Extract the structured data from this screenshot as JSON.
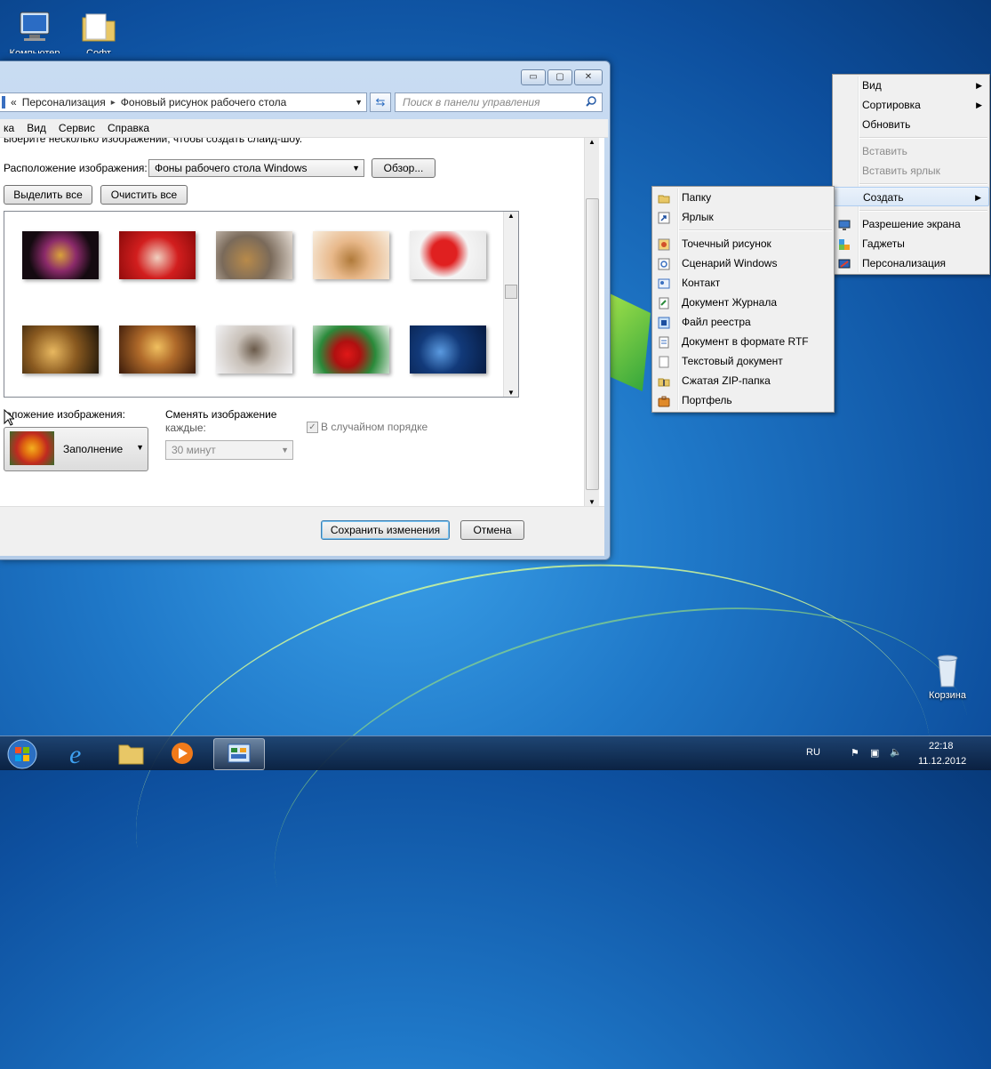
{
  "desktop": {
    "icons": [
      {
        "label": "Компьютер"
      },
      {
        "label": "Софт"
      },
      {
        "label": "Корзина"
      }
    ]
  },
  "window": {
    "controls": {
      "minimize": "▭",
      "maximize": "▢",
      "close": "✕"
    },
    "breadcrumb": {
      "sep": "«",
      "crumb1": "Персонализация",
      "crumb2": "Фоновый рисунок рабочего стола",
      "arrow": "▸"
    },
    "search_placeholder": "Поиск в панели управления",
    "menu": [
      "ка",
      "Вид",
      "Сервис",
      "Справка"
    ],
    "intro_text": "ыберите несколько изображений, чтобы создать слайд-шоу.",
    "location_label": "Расположение изображения:",
    "location_value": "Фоны рабочего стола Windows",
    "browse_label": "Обзор...",
    "select_all_label": "Выделить все",
    "clear_all_label": "Очистить все",
    "position_label": "оложение изображения:",
    "position_value": "Заполнение",
    "change_label_1": "Сменять изображение",
    "change_label_2": "каждые:",
    "interval_value": "30 минут",
    "shuffle_label": "В случайном порядке",
    "save_label": "Сохранить изменения",
    "cancel_label": "Отмена"
  },
  "context_menu": {
    "items": [
      {
        "label": "Вид",
        "sub": "▶"
      },
      {
        "label": "Сортировка",
        "sub": "▶"
      },
      {
        "label": "Обновить"
      },
      {
        "label": "Вставить"
      },
      {
        "label": "Вставить ярлык"
      },
      {
        "label": "Создать",
        "sub": "▶"
      },
      {
        "label": "Разрешение экрана"
      },
      {
        "label": "Гаджеты"
      },
      {
        "label": "Персонализация"
      }
    ]
  },
  "create_menu": {
    "items": [
      {
        "label": "Папку"
      },
      {
        "label": "Ярлык"
      },
      {
        "label": "Точечный рисунок"
      },
      {
        "label": "Сценарий Windows"
      },
      {
        "label": "Контакт"
      },
      {
        "label": "Документ Журнала"
      },
      {
        "label": "Файл реестра"
      },
      {
        "label": "Документ в формате RTF"
      },
      {
        "label": "Текстовый документ"
      },
      {
        "label": "Сжатая ZIP-папка"
      },
      {
        "label": "Портфель"
      }
    ]
  },
  "tray": {
    "lang": "RU",
    "time": "22:18",
    "date": "11.12.2012"
  },
  "colors": {
    "menu_highlight": "#dbe8f7",
    "desktop_blue": "#1f78c8"
  }
}
